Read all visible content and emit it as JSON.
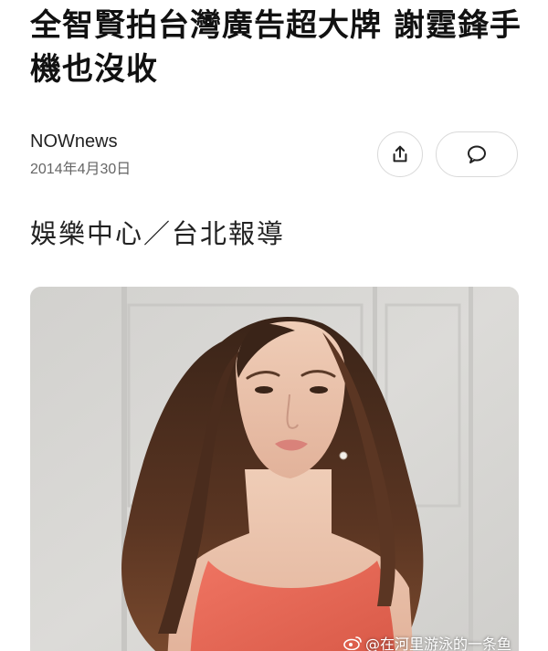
{
  "article": {
    "headline": "全智賢拍台灣廣告超大牌 謝霆鋒手機也沒收",
    "source": "NOWnews",
    "date": "2014年4月30日",
    "section": "娛樂中心／台北報導"
  },
  "actions": {
    "share_icon": "share-icon",
    "comment_icon": "comment-icon"
  },
  "photo": {
    "description_icon": "portrait-photo"
  },
  "watermark": {
    "text": "@在河里游泳的一条鱼",
    "icon": "weibo-logo"
  },
  "colors": {
    "headline": "#111111",
    "meta_date": "#666666",
    "button_border": "#d9d9d9",
    "dress": "#e96a58"
  }
}
